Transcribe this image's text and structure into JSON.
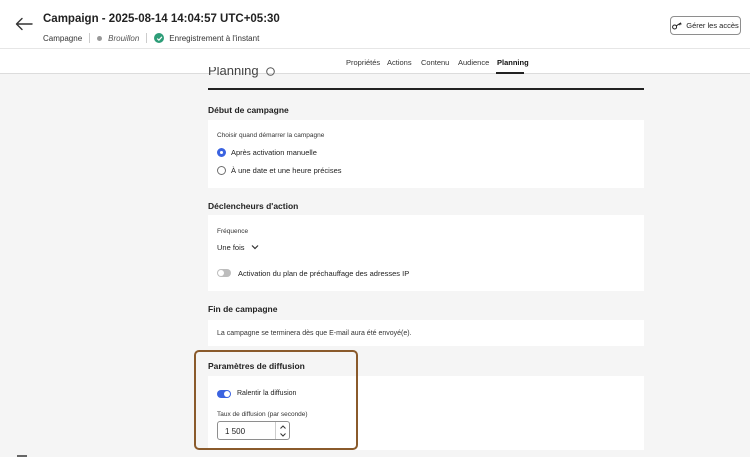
{
  "header": {
    "title": "Campaign - 2025-08-14 14:04:57 UTC+05:30",
    "type_label": "Campagne",
    "status_label": "Brouillon",
    "autosave_label": "Enregistrement à l'instant",
    "access_button": "Gérer les accès"
  },
  "tabs": [
    {
      "label": "Propriétés"
    },
    {
      "label": "Actions"
    },
    {
      "label": "Contenu"
    },
    {
      "label": "Audience"
    },
    {
      "label": "Planning",
      "active": true
    }
  ],
  "page_title": "Planning",
  "campaign_start": {
    "heading": "Début de campagne",
    "prompt": "Choisir quand démarrer la campagne",
    "options": [
      {
        "label": "Après activation manuelle",
        "selected": true
      },
      {
        "label": "À une date et une heure précises",
        "selected": false
      }
    ]
  },
  "action_triggers": {
    "heading": "Déclencheurs d'action",
    "frequency_label": "Fréquence",
    "frequency_value": "Une fois",
    "ip_warmup_label": "Activation du plan de préchauffage des adresses IP",
    "ip_warmup_on": false
  },
  "campaign_end": {
    "heading": "Fin de campagne",
    "message": "La campagne se terminera dès que E-mail aura été envoyé(e)."
  },
  "delivery_settings": {
    "heading": "Paramètres de diffusion",
    "throttle_label": "Ralentir la diffusion",
    "throttle_on": true,
    "rate_label": "Taux de diffusion (par seconde)",
    "rate_value": "1 500"
  },
  "colors": {
    "accent": "#3b63e0",
    "success": "#2d9d78",
    "highlight_border": "#8a5a2b"
  }
}
